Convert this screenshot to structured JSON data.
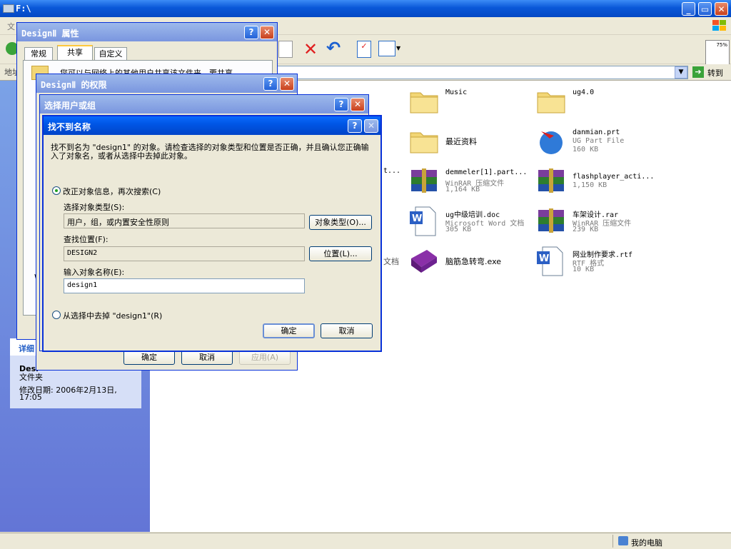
{
  "explorer": {
    "title": "F:\\",
    "menu_first": "文",
    "address_label": "地址",
    "go_label": "转到",
    "thumb_zoom": "75%",
    "status_computer": "我的电脑",
    "details": {
      "header": "详细",
      "name": "Desi",
      "type": "文件夹",
      "modified_label": "修改日期: 2006年2月13日,",
      "modified_time": "17:05"
    },
    "partial_texts": [
      "t...",
      "文档"
    ],
    "files": [
      {
        "name": "Music",
        "type": "",
        "size": "",
        "icon": "folder-icon"
      },
      {
        "name": "ug4.0",
        "type": "",
        "size": "",
        "icon": "folder-icon"
      },
      {
        "name": "最近资料",
        "type": "",
        "size": "",
        "icon": "folder-icon"
      },
      {
        "name": "danmian.prt",
        "type": "UG Part File",
        "size": "160 KB",
        "icon": "ug-part-icon"
      },
      {
        "name": "demmeler[1].part...",
        "type": "WinRAR 压缩文件",
        "size": "1,164 KB",
        "icon": "winrar-icon"
      },
      {
        "name": "flashplayer_acti...",
        "type": "",
        "size": "1,150 KB",
        "icon": "winrar-icon"
      },
      {
        "name": "ug中级培训.doc",
        "type": "Microsoft Word 文档",
        "size": "305 KB",
        "icon": "word-doc-icon"
      },
      {
        "name": "车架设计.rar",
        "type": "WinRAR 压缩文件",
        "size": "239 KB",
        "icon": "winrar-icon"
      },
      {
        "name": "脑筋急转弯.exe",
        "type": "",
        "size": "",
        "icon": "book-exe-icon"
      },
      {
        "name": "网业制作要求.rtf",
        "type": "RTF 格式",
        "size": "10 KB",
        "icon": "rtf-doc-icon"
      }
    ]
  },
  "properties_dialog": {
    "title": "DesignⅡ 属性",
    "tabs": [
      "常规",
      "共享",
      "自定义"
    ],
    "partial_text": "您可以与网络上的其他用户共享该文件夹。要共享",
    "side_text": "W",
    "ok": "确定",
    "cancel": "取消",
    "apply": "应用(A)"
  },
  "permissions_dialog": {
    "title": "DesignⅡ 的权限"
  },
  "select_dialog": {
    "title": "选择用户或组"
  },
  "error_dialog": {
    "title": "找不到名称",
    "message": "找不到名为 \"design1\" 的对象。请检查选择的对象类型和位置是否正确，并且确认您正确输入了对象名，或者从选择中去掉此对象。",
    "option_fix": "改正对象信息，再次搜索(C)",
    "object_type_label": "选择对象类型(S):",
    "object_type_value": "用户，组，或内置安全性原则",
    "object_type_button": "对象类型(O)...",
    "location_label": "查找位置(F):",
    "location_value": "DESIGN2",
    "location_button": "位置(L)...",
    "name_label": "输入对象名称(E):",
    "name_value": "design1",
    "option_remove": "从选择中去掉 \"design1\"(R)",
    "ok": "确定",
    "cancel": "取消"
  }
}
